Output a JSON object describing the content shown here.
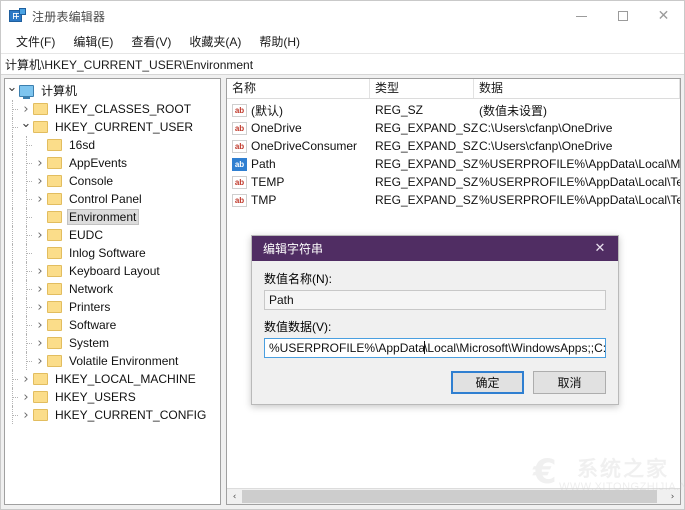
{
  "window": {
    "title": "注册表编辑器",
    "icon": "registry-editor-icon",
    "minimize_label": "─",
    "maximize_label": "□",
    "close_label": "✕"
  },
  "menubar": {
    "items": [
      {
        "label": "文件(F)",
        "name": "menu-file"
      },
      {
        "label": "编辑(E)",
        "name": "menu-edit"
      },
      {
        "label": "查看(V)",
        "name": "menu-view"
      },
      {
        "label": "收藏夹(A)",
        "name": "menu-favorites"
      },
      {
        "label": "帮助(H)",
        "name": "menu-help"
      }
    ]
  },
  "address": {
    "path": "计算机\\HKEY_CURRENT_USER\\Environment"
  },
  "tree": {
    "nodes": [
      {
        "label": "计算机",
        "depth": 0,
        "icon": "monitor-icon",
        "state": "expanded",
        "selected": false
      },
      {
        "label": "HKEY_CLASSES_ROOT",
        "depth": 1,
        "icon": "folder-icon",
        "state": "collapsed",
        "selected": false
      },
      {
        "label": "HKEY_CURRENT_USER",
        "depth": 1,
        "icon": "folder-icon",
        "state": "expanded",
        "selected": false
      },
      {
        "label": "16sd",
        "depth": 2,
        "icon": "folder-icon",
        "state": "leaf",
        "selected": false
      },
      {
        "label": "AppEvents",
        "depth": 2,
        "icon": "folder-icon",
        "state": "collapsed",
        "selected": false
      },
      {
        "label": "Console",
        "depth": 2,
        "icon": "folder-icon",
        "state": "collapsed",
        "selected": false
      },
      {
        "label": "Control Panel",
        "depth": 2,
        "icon": "folder-icon",
        "state": "collapsed",
        "selected": false
      },
      {
        "label": "Environment",
        "depth": 2,
        "icon": "folder-icon",
        "state": "leaf",
        "selected": true
      },
      {
        "label": "EUDC",
        "depth": 2,
        "icon": "folder-icon",
        "state": "collapsed",
        "selected": false
      },
      {
        "label": "Inlog Software",
        "depth": 2,
        "icon": "folder-icon",
        "state": "leaf",
        "selected": false
      },
      {
        "label": "Keyboard Layout",
        "depth": 2,
        "icon": "folder-icon",
        "state": "collapsed",
        "selected": false
      },
      {
        "label": "Network",
        "depth": 2,
        "icon": "folder-icon",
        "state": "collapsed",
        "selected": false
      },
      {
        "label": "Printers",
        "depth": 2,
        "icon": "folder-icon",
        "state": "collapsed",
        "selected": false
      },
      {
        "label": "Software",
        "depth": 2,
        "icon": "folder-icon",
        "state": "collapsed",
        "selected": false
      },
      {
        "label": "System",
        "depth": 2,
        "icon": "folder-icon",
        "state": "collapsed",
        "selected": false
      },
      {
        "label": "Volatile Environment",
        "depth": 2,
        "icon": "folder-icon",
        "state": "collapsed",
        "selected": false
      },
      {
        "label": "HKEY_LOCAL_MACHINE",
        "depth": 1,
        "icon": "folder-icon",
        "state": "collapsed",
        "selected": false
      },
      {
        "label": "HKEY_USERS",
        "depth": 1,
        "icon": "folder-icon",
        "state": "collapsed",
        "selected": false
      },
      {
        "label": "HKEY_CURRENT_CONFIG",
        "depth": 1,
        "icon": "folder-icon",
        "state": "collapsed",
        "selected": false
      }
    ]
  },
  "list": {
    "columns": [
      "名称",
      "类型",
      "数据"
    ],
    "rows": [
      {
        "name": "(默认)",
        "type": "REG_SZ",
        "data": "(数值未设置)",
        "icon": "string-value-icon",
        "selected": false
      },
      {
        "name": "OneDrive",
        "type": "REG_EXPAND_SZ",
        "data": "C:\\Users\\cfanp\\OneDrive",
        "icon": "string-value-icon",
        "selected": false
      },
      {
        "name": "OneDriveConsumer",
        "type": "REG_EXPAND_SZ",
        "data": "C:\\Users\\cfanp\\OneDrive",
        "icon": "string-value-icon",
        "selected": false
      },
      {
        "name": "Path",
        "type": "REG_EXPAND_SZ",
        "data": "%USERPROFILE%\\AppData\\Local\\Microsoft\\..",
        "icon": "string-value-icon",
        "selected": true
      },
      {
        "name": "TEMP",
        "type": "REG_EXPAND_SZ",
        "data": "%USERPROFILE%\\AppData\\Local\\Temp",
        "icon": "string-value-icon",
        "selected": false
      },
      {
        "name": "TMP",
        "type": "REG_EXPAND_SZ",
        "data": "%USERPROFILE%\\AppData\\Local\\Temp",
        "icon": "string-value-icon",
        "selected": false
      }
    ],
    "scroll_left_arrow": "‹",
    "scroll_right_arrow": "›"
  },
  "dialog": {
    "title": "编辑字符串",
    "close_label": "✕",
    "name_label": "数值名称(N):",
    "name_value": "Path",
    "data_label": "数值数据(V):",
    "data_value_before_caret": "%USERPROFILE%\\AppData",
    "data_value_after_caret": "\\Local\\Microsoft\\WindowsApps;;C:\\Users\\cf.",
    "ok_label": "确定",
    "cancel_label": "取消"
  },
  "watermark": {
    "logo": "€",
    "cn": "系统之家",
    "en": "WWW.XITONGZHIJIA.NET"
  },
  "colors": {
    "dialog_titlebar": "#502d63",
    "selection_blue": "#2f7fd1",
    "folder_yellow": "#fbdd8a",
    "tree_selection_gray": "#dcdcdc"
  }
}
